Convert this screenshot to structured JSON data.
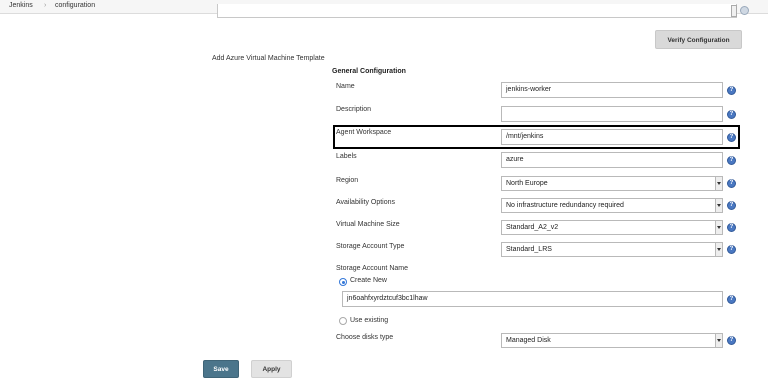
{
  "breadcrumb": {
    "items": [
      "Jenkins",
      "configuration"
    ],
    "separator": "›"
  },
  "buttons": {
    "verify": "Verify Configuration",
    "save": "Save",
    "apply": "Apply"
  },
  "section": {
    "title": "Add Azure Virtual Machine Template",
    "subsection": "General Configuration"
  },
  "fields": {
    "name": {
      "label": "Name",
      "value": "jenkins-worker"
    },
    "description": {
      "label": "Description",
      "value": ""
    },
    "agent_workspace": {
      "label": "Agent Workspace",
      "value": "/mnt/jenkins"
    },
    "labels": {
      "label": "Labels",
      "value": "azure"
    },
    "region": {
      "label": "Region",
      "value": "North Europe"
    },
    "availability": {
      "label": "Availability Options",
      "value": "No infrastructure redundancy required"
    },
    "vm_size": {
      "label": "Virtual Machine Size",
      "value": "Standard_A2_v2"
    },
    "storage_type": {
      "label": "Storage Account Type",
      "value": "Standard_LRS"
    },
    "storage_name": {
      "label": "Storage Account Name",
      "create_new": "Create New",
      "use_existing": "Use existing",
      "new_value": "jn6oahfxyrdztcuf3bc1lhaw"
    },
    "disk_type": {
      "label": "Choose disks type",
      "value": "Managed Disk"
    }
  },
  "help_glyph": "?",
  "colors": {
    "accent": "#4b758b",
    "help": "#4a78c2"
  }
}
